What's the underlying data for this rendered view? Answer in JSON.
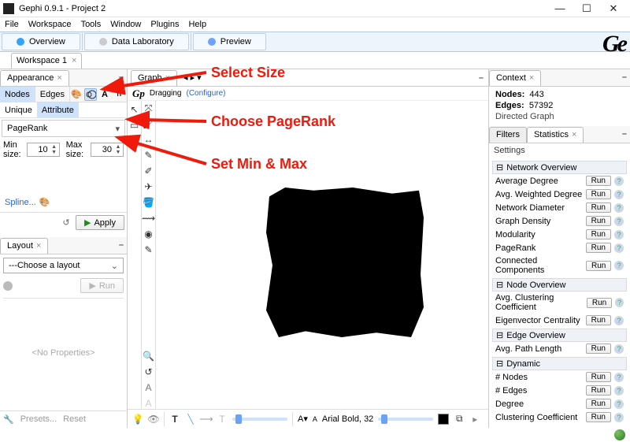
{
  "window": {
    "title": "Gephi 0.9.1 - Project 2"
  },
  "menu": [
    "File",
    "Workspace",
    "Tools",
    "Window",
    "Plugins",
    "Help"
  ],
  "modes": {
    "overview": "Overview",
    "datalab": "Data Laboratory",
    "preview": "Preview"
  },
  "workspace": {
    "tab": "Workspace 1"
  },
  "appearance": {
    "tab": "Appearance",
    "nodes": "Nodes",
    "edges": "Edges",
    "unique": "Unique",
    "attribute": "Attribute",
    "attr_selected": "PageRank",
    "min_label": "Min size:",
    "min_value": "10",
    "max_label": "Max size:",
    "max_value": "30",
    "spline": "Spline...",
    "apply": "Apply",
    "icons": {
      "color": "color-palette-icon",
      "size": "size-rings-icon",
      "label": "label-color-icon",
      "labelsize": "label-size-icon"
    }
  },
  "layout": {
    "tab": "Layout",
    "choose": "---Choose a layout",
    "run": "Run",
    "noprops": "<No Properties>",
    "presets": "Presets...",
    "reset": "Reset"
  },
  "graph": {
    "tab": "Graph",
    "gp": "Gp",
    "dragging": "Dragging",
    "configure": "(Configure)",
    "font": "Arial Bold, 32",
    "font_prefix": "A▾",
    "font_small": "A"
  },
  "context": {
    "tab": "Context",
    "nodes_label": "Nodes:",
    "nodes_value": "443",
    "edges_label": "Edges:",
    "edges_value": "57392",
    "type": "Directed Graph"
  },
  "filters": {
    "tab": "Filters",
    "stats_tab": "Statistics",
    "settings": "Settings",
    "run": "Run",
    "groups": {
      "net": "Network Overview",
      "node": "Node Overview",
      "edge": "Edge Overview",
      "dyn": "Dynamic"
    },
    "metrics": {
      "avg_degree": "Average Degree",
      "avg_w_degree": "Avg. Weighted Degree",
      "diameter": "Network Diameter",
      "density": "Graph Density",
      "modularity": "Modularity",
      "pagerank": "PageRank",
      "cc": "Connected Components",
      "avg_clust": "Avg. Clustering Coefficient",
      "eigen": "Eigenvector Centrality",
      "avg_path": "Avg. Path Length",
      "dyn_nodes": "# Nodes",
      "dyn_edges": "# Edges",
      "degree": "Degree",
      "clust": "Clustering Coefficient"
    }
  },
  "annotations": {
    "size": "Select Size",
    "pagerank": "Choose PageRank",
    "minmax": "Set Min & Max"
  }
}
